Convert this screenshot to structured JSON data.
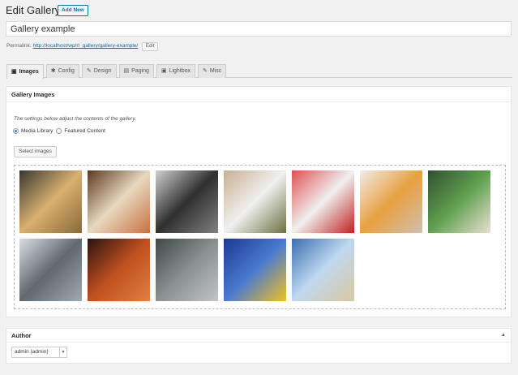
{
  "header": {
    "title": "Edit Gallery",
    "add_new": "Add New"
  },
  "post_title": "Gallery example",
  "permalink": {
    "label": "Permalink:",
    "url": "http://localhost/wp/rl_gallery/gallery-example/",
    "edit": "Edit"
  },
  "tabs": [
    {
      "label": "Images",
      "icon": "image-icon",
      "glyph": "▣"
    },
    {
      "label": "Config",
      "icon": "gear-icon",
      "glyph": "✱"
    },
    {
      "label": "Design",
      "icon": "brush-icon",
      "glyph": "✎"
    },
    {
      "label": "Paging",
      "icon": "paging-icon",
      "glyph": "▤"
    },
    {
      "label": "Lightbox",
      "icon": "lightbox-icon",
      "glyph": "▣"
    },
    {
      "label": "Misc",
      "icon": "wrench-icon",
      "glyph": "✎"
    }
  ],
  "panel": {
    "title": "Gallery Images",
    "description": "The settings below adjust the contents of the gallery.",
    "radio_media": "Media Library",
    "radio_featured": "Featured Content",
    "select_images": "Select images"
  },
  "images": [
    {
      "name": "toast-pan",
      "colors": [
        "#3a3530",
        "#d8b070",
        "#8a6a3a"
      ]
    },
    {
      "name": "tea-table",
      "colors": [
        "#5a3a20",
        "#e8d8c0",
        "#c87040"
      ]
    },
    {
      "name": "devices-desk",
      "colors": [
        "#d0d0d0",
        "#303030",
        "#808080"
      ]
    },
    {
      "name": "food-board",
      "colors": [
        "#c8b090",
        "#f0f0f0",
        "#6a7040"
      ]
    },
    {
      "name": "strawberries",
      "colors": [
        "#e05050",
        "#f0f0f0",
        "#c02020"
      ]
    },
    {
      "name": "breakfast",
      "colors": [
        "#f0ece8",
        "#e8a040",
        "#d0c0b0"
      ]
    },
    {
      "name": "salad",
      "colors": [
        "#305030",
        "#60a050",
        "#e8e0d0"
      ]
    },
    {
      "name": "mountains",
      "colors": [
        "#d8dde0",
        "#606870",
        "#a0a8b0"
      ]
    },
    {
      "name": "canyon",
      "colors": [
        "#2a1410",
        "#c05020",
        "#e08040"
      ]
    },
    {
      "name": "coast-cliffs",
      "colors": [
        "#404848",
        "#8a9090",
        "#c0c4c4"
      ]
    },
    {
      "name": "sunflowers",
      "colors": [
        "#1a3a90",
        "#4a7ad0",
        "#f0c020"
      ]
    },
    {
      "name": "fence-field",
      "colors": [
        "#3a70b0",
        "#c0d8f0",
        "#d8c8a0"
      ]
    }
  ],
  "author": {
    "title": "Author",
    "value": "admin (admin)"
  }
}
